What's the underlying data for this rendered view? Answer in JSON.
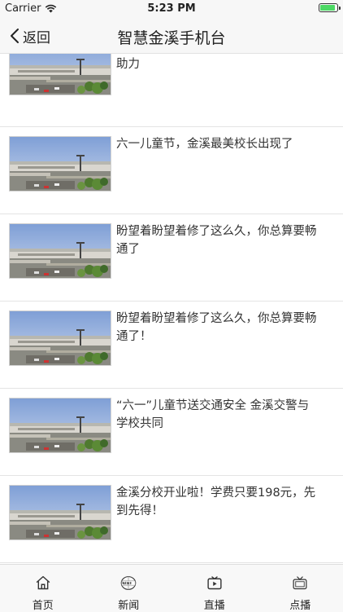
{
  "status": {
    "carrier": "Carrier",
    "time": "5:23 PM"
  },
  "nav": {
    "back_label": "返回",
    "title": "智慧金溪手机台"
  },
  "news": [
    {
      "title": "战斗机、直升机降落金溪 为金溪福彩助力"
    },
    {
      "title": "六一儿童节，金溪最美校长出现了"
    },
    {
      "title": "盼望着盼望着修了这么久，你总算要畅通了"
    },
    {
      "title": "盼望着盼望着修了这么久，你总算要畅通了！"
    },
    {
      "title": "“六一”儿童节送交通安全 金溪交警与学校共同"
    },
    {
      "title": "金溪分校开业啦！学费只要198元，先到先得！"
    }
  ],
  "tabs": [
    {
      "label": "首页",
      "icon": "home-icon"
    },
    {
      "label": "新闻",
      "icon": "news-icon"
    },
    {
      "label": "直播",
      "icon": "live-icon"
    },
    {
      "label": "点播",
      "icon": "tv-icon"
    }
  ]
}
